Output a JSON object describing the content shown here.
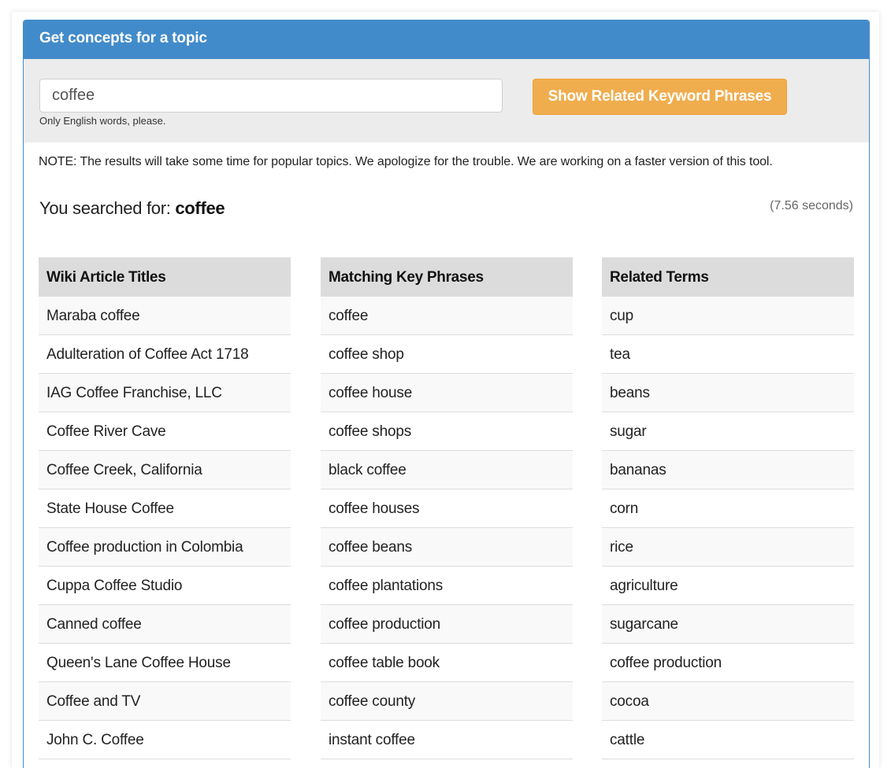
{
  "header": {
    "title": "Get concepts for a topic"
  },
  "search": {
    "value": "coffee",
    "hint": "Only English words, please.",
    "button_label": "Show Related Keyword Phrases"
  },
  "note": "NOTE: The results will take some time for popular topics. We apologize for the trouble. We are working on a faster version of this tool.",
  "result": {
    "prefix": "You searched for: ",
    "term": "coffee",
    "timing": "(7.56 seconds)"
  },
  "columns": [
    {
      "header": "Wiki Article Titles",
      "items": [
        "Maraba coffee",
        "Adulteration of Coffee Act 1718",
        "IAG Coffee Franchise, LLC",
        "Coffee River Cave",
        "Coffee Creek, California",
        "State House Coffee",
        "Coffee production in Colombia",
        "Cuppa Coffee Studio",
        "Canned coffee",
        "Queen's Lane Coffee House",
        "Coffee and TV",
        "John C. Coffee"
      ]
    },
    {
      "header": "Matching Key Phrases",
      "items": [
        "coffee",
        "coffee shop",
        "coffee house",
        "coffee shops",
        "black coffee",
        "coffee houses",
        "coffee beans",
        "coffee plantations",
        "coffee production",
        "coffee table book",
        "coffee county",
        "instant coffee"
      ]
    },
    {
      "header": "Related Terms",
      "items": [
        "cup",
        "tea",
        "beans",
        "sugar",
        "bananas",
        "corn",
        "rice",
        "agriculture",
        "sugarcane",
        "coffee production",
        "cocoa",
        "cattle"
      ]
    }
  ],
  "colors": {
    "header_bg": "#428bca",
    "button_bg": "#f0ad4e",
    "search_area_bg": "#ececec",
    "column_header_bg": "#dcdcdc"
  }
}
